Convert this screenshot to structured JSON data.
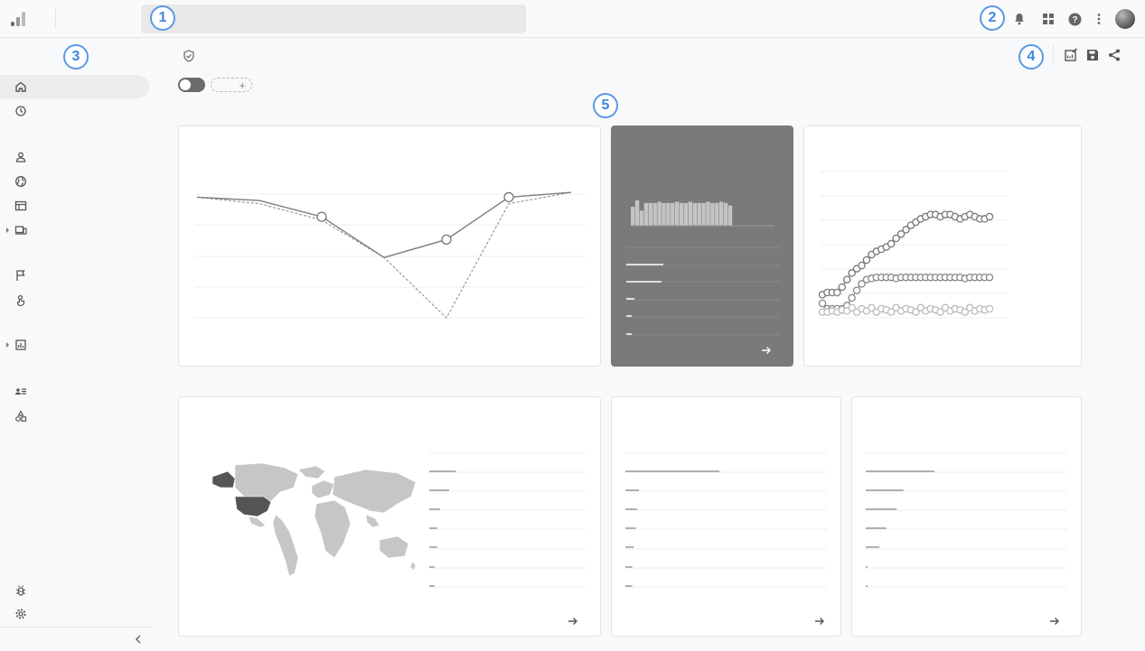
{
  "topbar": {
    "search_placeholder": "",
    "icons": [
      "analytics-logo-icon",
      "bell-icon",
      "apps-grid-icon",
      "help-icon",
      "more-vert-icon",
      "avatar"
    ]
  },
  "callouts": [
    "1",
    "2",
    "3",
    "4",
    "5"
  ],
  "sidebar": {
    "items": [
      {
        "icon": "home-icon",
        "active": true
      },
      {
        "icon": "clock-icon"
      },
      {
        "icon": "person-icon"
      },
      {
        "icon": "globe-icon"
      },
      {
        "icon": "table-icon"
      },
      {
        "icon": "devices-icon",
        "expandable": true
      },
      {
        "icon": "flag-icon"
      },
      {
        "icon": "touch-icon"
      },
      {
        "icon": "report-icon",
        "expandable": true
      },
      {
        "icon": "person-list-icon"
      },
      {
        "icon": "shapes-icon"
      },
      {
        "icon": "bug-icon"
      },
      {
        "icon": "gear-icon"
      }
    ]
  },
  "header": {
    "add_chip_label": "+"
  },
  "colors": {
    "accent": "#5a9ae6",
    "dark_card": "#7a7a7a",
    "line": "#7d7d7d",
    "map_land": "#c6c6c6",
    "map_highlight": "#555555"
  },
  "chart_data": [
    {
      "type": "line",
      "series": [
        {
          "values": [
            0.52,
            0.5,
            0.4,
            0.15,
            0.26,
            0.52,
            0.55
          ]
        },
        {
          "values": [
            0.52,
            0.48,
            0.38,
            0.15,
            -0.22,
            0.48,
            0.55
          ]
        }
      ]
    },
    {
      "type": "bar",
      "values": [
        0.75,
        1.0,
        0.6,
        0.9,
        0.9,
        0.9,
        0.95,
        0.9,
        0.9,
        0.9,
        0.95,
        0.9,
        0.9,
        0.95,
        0.9,
        0.9,
        0.9,
        0.95,
        0.9,
        0.9,
        0.95,
        0.9,
        0.8
      ]
    },
    {
      "type": "scatter",
      "series": [
        {
          "values": [
            0.18,
            0.2,
            0.2,
            0.2,
            0.25,
            0.32,
            0.38,
            0.42,
            0.45,
            0.5,
            0.55,
            0.58,
            0.6,
            0.62,
            0.65,
            0.7,
            0.74,
            0.78,
            0.82,
            0.85,
            0.88,
            0.9,
            0.92,
            0.92,
            0.9,
            0.92,
            0.92,
            0.9,
            0.88,
            0.9,
            0.92,
            0.9,
            0.88,
            0.88,
            0.9
          ]
        },
        {
          "values": [
            0.1,
            0.05,
            0.05,
            0.05,
            0.05,
            0.08,
            0.15,
            0.22,
            0.28,
            0.32,
            0.33,
            0.34,
            0.34,
            0.34,
            0.34,
            0.33,
            0.34,
            0.34,
            0.34,
            0.34,
            0.34,
            0.34,
            0.34,
            0.34,
            0.34,
            0.34,
            0.34,
            0.34,
            0.34,
            0.33,
            0.34,
            0.34,
            0.34,
            0.34,
            0.34
          ]
        },
        {
          "values": [
            0.02,
            0.02,
            0.03,
            0.02,
            0.04,
            0.03,
            0.06,
            0.02,
            0.05,
            0.03,
            0.06,
            0.02,
            0.05,
            0.04,
            0.02,
            0.06,
            0.03,
            0.05,
            0.04,
            0.02,
            0.06,
            0.03,
            0.05,
            0.04,
            0.02,
            0.06,
            0.03,
            0.05,
            0.04,
            0.02,
            0.06,
            0.03,
            0.05,
            0.04,
            0.05
          ]
        }
      ]
    },
    {
      "type": "table",
      "bars": [
        0.2,
        0.15,
        0.08,
        0.06,
        0.06,
        0.04,
        0.04
      ]
    },
    {
      "type": "table",
      "bars": [
        0.55,
        0.08,
        0.07,
        0.06,
        0.05,
        0.04,
        0.04
      ]
    },
    {
      "type": "table",
      "bars": [
        0.4,
        0.22,
        0.18,
        0.12,
        0.08,
        0.01,
        0.005
      ]
    },
    {
      "type": "table",
      "bars": [
        0.25,
        0.2,
        0.1,
        0.08,
        0.08,
        0.05,
        0.05
      ]
    }
  ]
}
